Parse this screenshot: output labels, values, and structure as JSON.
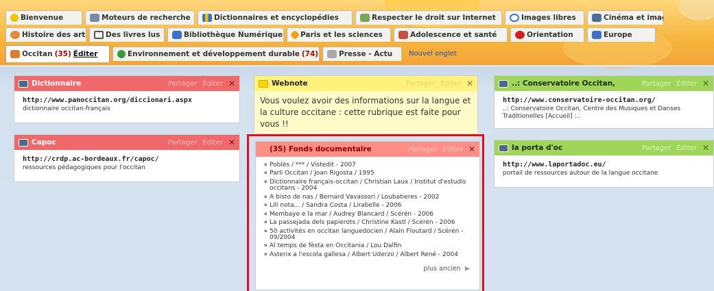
{
  "tabs_row1": [
    {
      "label": "Bienvenue",
      "icon": "smiley-icon",
      "color": "#f5c400"
    },
    {
      "label": "Moteurs de recherche",
      "icon": "monitor-icon",
      "color": "#7a8aa0"
    },
    {
      "label": "Dictionnaires et encyclopédies",
      "icon": "bar-chart-icon",
      "color": "#3b6fc8"
    },
    {
      "label": "Respecter le droit sur Internet",
      "icon": "document-icon",
      "color": "#7ca55a"
    },
    {
      "label": "Images libres",
      "icon": "eye-icon",
      "color": "#3b6fc8"
    },
    {
      "label": "Cinéma et image",
      "icon": "film-icon",
      "color": "#4f6e9a"
    }
  ],
  "tabs_row2": [
    {
      "label": "Histoire des arts",
      "icon": "palette-icon",
      "color": "#e08a3a"
    },
    {
      "label": "Des livres lus",
      "icon": "music-note-icon",
      "color": "#555"
    },
    {
      "label": "Bibliothèque Numérique",
      "icon": "book-icon",
      "color": "#3b6fc8"
    },
    {
      "label": "Paris et les sciences",
      "icon": "star-icon",
      "color": "#f0a000"
    },
    {
      "label": "Adolescence et santé",
      "icon": "person-icon",
      "color": "#c8503a"
    },
    {
      "label": "Orientation",
      "icon": "ribbon-icon",
      "color": "#d42020"
    },
    {
      "label": "Europe",
      "icon": "map-icon",
      "color": "#3b6fc8"
    }
  ],
  "tabs_row3": {
    "active": {
      "label": "Occitan",
      "count": "(35)",
      "edit": "Éditer",
      "icon": "folder-icon",
      "color": "#e07a30"
    },
    "others": [
      {
        "label": "Environnement et développement durable",
        "count": "(74)",
        "icon": "globe-icon",
        "color": "#3a9a3a"
      },
      {
        "label": "Presse - Actu",
        "count": "",
        "icon": "newspaper-icon",
        "color": "#888"
      }
    ],
    "new_tab": "Nouvel onglet"
  },
  "widgets": {
    "dictionnaire": {
      "title": "Dictionnaire",
      "share": "Partager",
      "edit": "Éditer",
      "url": "http://www.panoccitan.org/diccionari.aspx",
      "desc": "dictionnaire occitan-français"
    },
    "capoc": {
      "title": "Capoc",
      "share": "Partager",
      "edit": "Éditer",
      "url": "http://crdp.ac-bordeaux.fr/capoc/",
      "desc": "ressources pédagogiques pour l'occitan"
    },
    "webnote": {
      "title": "Webnote",
      "share": "Partager",
      "edit": "Éditer",
      "text": "Vous voulez avoir des informations sur la langue et la culture occitane : cette rubrique est faite pour vous !!"
    },
    "fonds": {
      "count": "(35)",
      "title": "Fonds documentaire",
      "share": "Partager",
      "edit": "Éditer",
      "items": [
        "Poblès / *** / Vistedit - 2007",
        "Parli Occitan / Joan Rigosta / 1995",
        "Dictionnaire français-occitan / Christian Laux / Institut d'estudis occitans - 2004",
        "A bisto de nas / Bernard Vavassori / Loubatieres - 2002",
        "Lili nota... / Sandra Costa / Lirabelle - 2006",
        "Membaye e la mar / Audrey Blancard / Scérén - 2006",
        "La passejada dels papierots / Christine Kastl / Scérén - 2006",
        "50 activités en occitan languedocien / Alain Floutard / Scérén - 09/2004",
        "Al temps de fèsta en Occitania / Lou Dalfin",
        "Asterix a l'escola gallesa / Albert Uderzo / Albert René - 2004"
      ],
      "more": "plus ancien"
    },
    "conservatoire": {
      "title": "..: Conservatoire Occitan,",
      "share": "Partager",
      "edit": "Éditer",
      "url": "http://www.conservatoire-occitan.org/",
      "desc": "..: Conservatoire Occitan, Centre des Musiques et Danses Traditionelles [Accueil] :.."
    },
    "porta": {
      "title": "la porta d'oc",
      "share": "Partager",
      "edit": "Éditer",
      "url": "http://www.laportadoc.eu/",
      "desc": "portail de ressources autour de la langue occitane"
    }
  }
}
